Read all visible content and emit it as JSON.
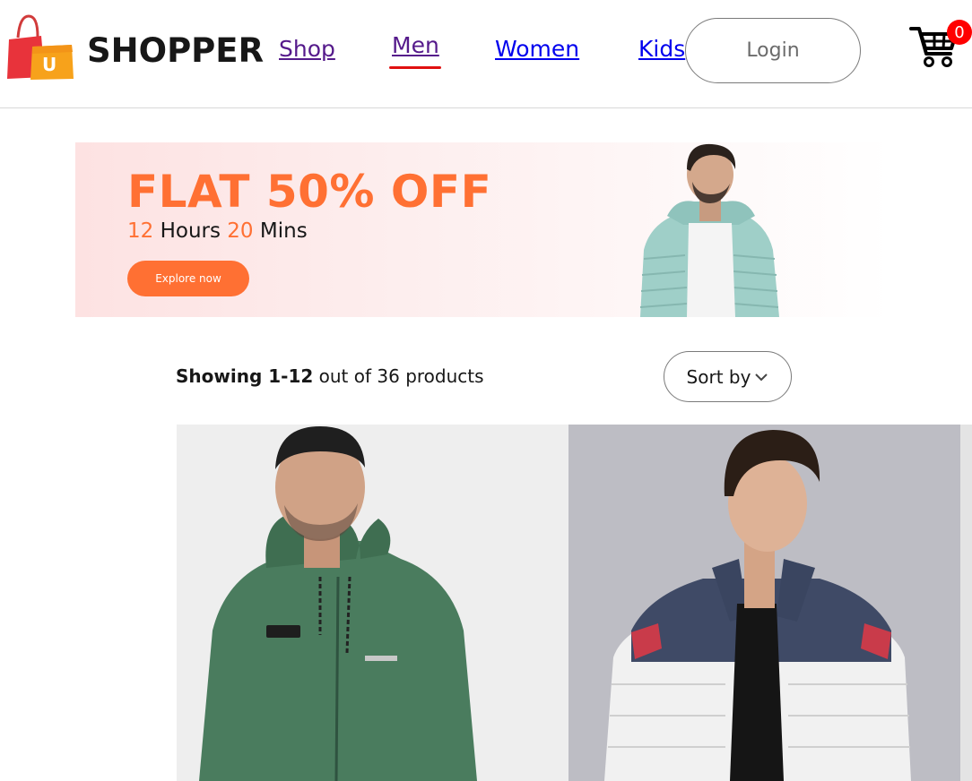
{
  "brand": {
    "name": "SHOPPER",
    "logo_letter": "U",
    "logo_icon": "shopping-bag-icon"
  },
  "nav": {
    "links": [
      {
        "label": "Shop"
      },
      {
        "label": "Men",
        "active": true
      },
      {
        "label": "Women"
      },
      {
        "label": "Kids"
      }
    ],
    "login_label": "Login",
    "cart_icon": "cart-icon",
    "cart_count": "0"
  },
  "banner": {
    "title": "FLAT 50% OFF",
    "hours": "12",
    "hours_label": "Hours",
    "mins": "20",
    "mins_label": "Mins",
    "button_label": "Explore now"
  },
  "listing": {
    "showing_range": "Showing 1-12",
    "showing_rest": "out of 36 products",
    "sort_label": "Sort by",
    "sort_icon": "chevron-down-icon"
  },
  "colors": {
    "accent": "#ff7033",
    "active_underline": "#e01111",
    "badge": "#ff0000",
    "visited_link": "#551a8b",
    "link": "#0000ee"
  }
}
